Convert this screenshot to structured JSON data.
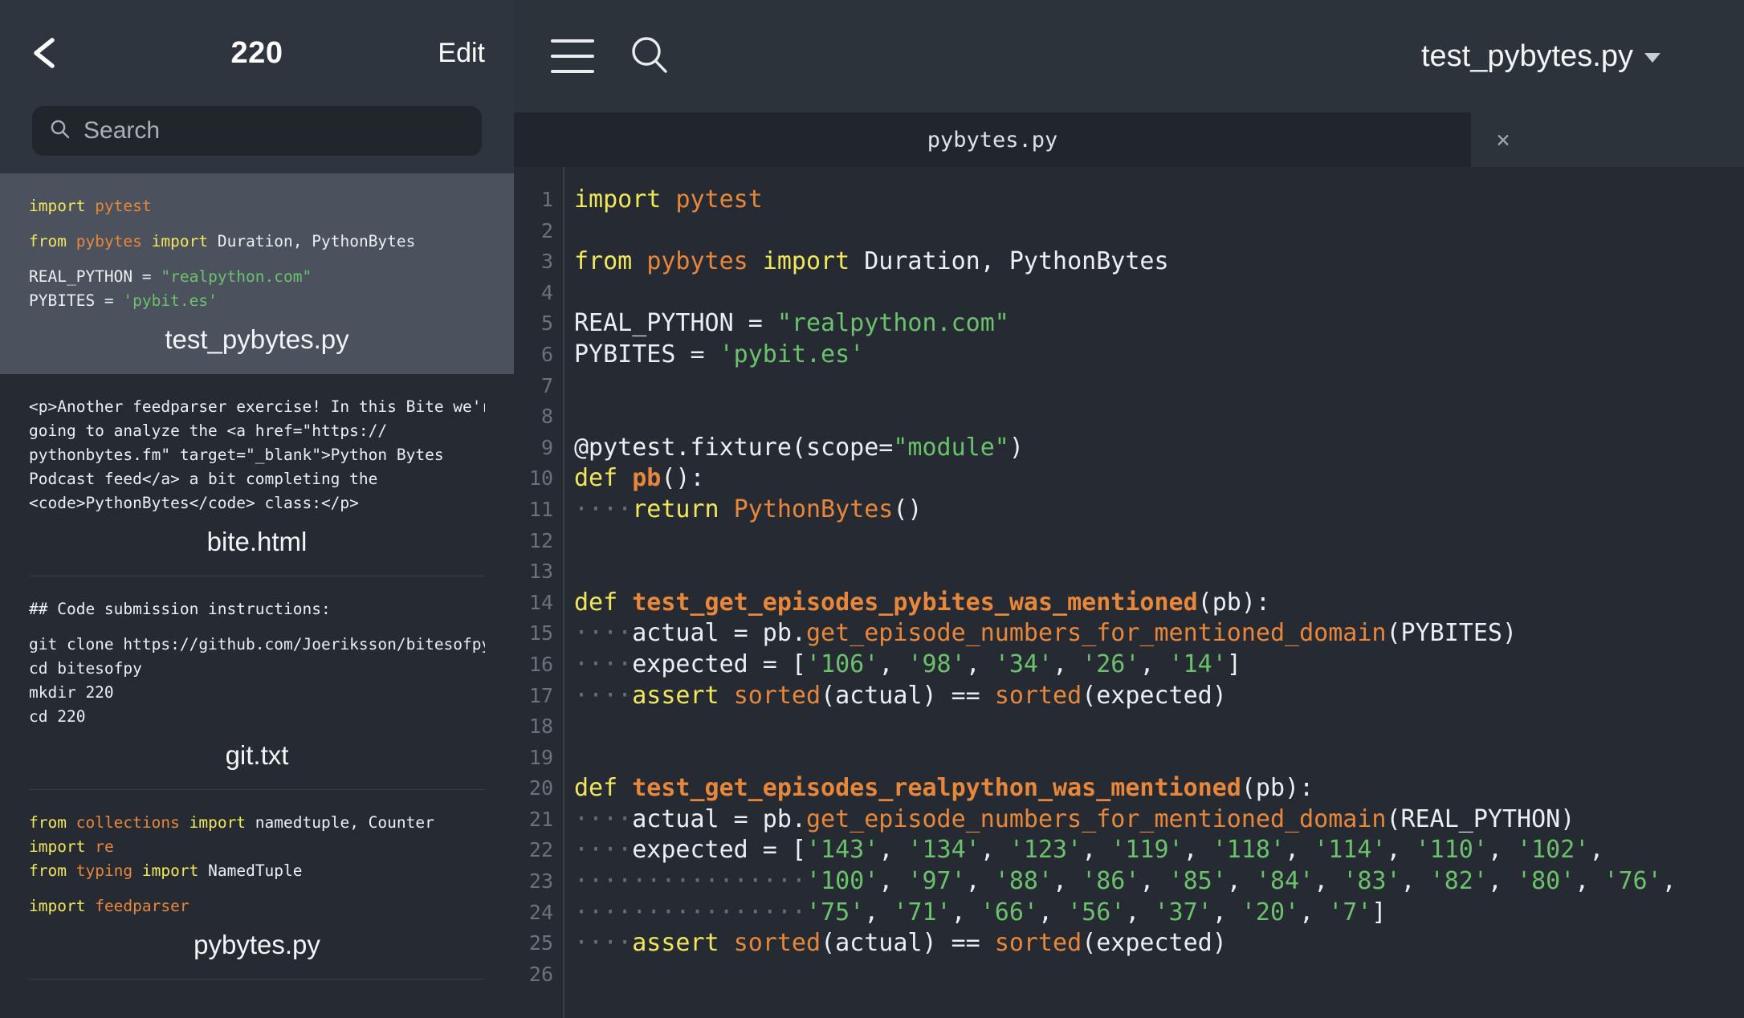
{
  "sidebar": {
    "back_icon": "chevron-left-icon",
    "title": "220",
    "edit_label": "Edit",
    "search": {
      "icon": "search-icon",
      "placeholder": "Search",
      "value": ""
    },
    "items": [
      {
        "filename": "test_pybytes.py",
        "selected": true,
        "snippet_lines": [
          [
            {
              "t": "import",
              "c": "kw"
            },
            {
              "t": " ",
              "c": "plain"
            },
            {
              "t": "pytest",
              "c": "mod"
            }
          ],
          [],
          [
            {
              "t": "from",
              "c": "kw"
            },
            {
              "t": " ",
              "c": "plain"
            },
            {
              "t": "pybytes",
              "c": "mod"
            },
            {
              "t": " ",
              "c": "plain"
            },
            {
              "t": "import",
              "c": "kw"
            },
            {
              "t": " Duration, PythonBytes",
              "c": "plain"
            }
          ],
          [],
          [
            {
              "t": "REAL_PYTHON = ",
              "c": "plain"
            },
            {
              "t": "\"realpython.com\"",
              "c": "str"
            }
          ],
          [
            {
              "t": "PYBITES = ",
              "c": "plain"
            },
            {
              "t": "'pybit.es'",
              "c": "str"
            }
          ]
        ]
      },
      {
        "filename": "bite.html",
        "selected": false,
        "snippet_lines": [
          [
            {
              "t": "<p>Another feedparser exercise! In this Bite we're",
              "c": "plain"
            }
          ],
          [
            {
              "t": "going to analyze the <a href=\"https://",
              "c": "plain"
            }
          ],
          [
            {
              "t": "pythonbytes.fm\" target=\"_blank\">Python Bytes",
              "c": "plain"
            }
          ],
          [
            {
              "t": "Podcast feed</a> a bit completing the",
              "c": "plain"
            }
          ],
          [
            {
              "t": "<code>PythonBytes</code> class:</p>",
              "c": "plain"
            }
          ]
        ]
      },
      {
        "filename": "git.txt",
        "selected": false,
        "snippet_lines": [
          [
            {
              "t": "## Code submission instructions:",
              "c": "plain"
            }
          ],
          [],
          [
            {
              "t": "git clone https://github.com/Joeriksson/bitesofpy",
              "c": "plain"
            }
          ],
          [
            {
              "t": "cd bitesofpy",
              "c": "plain"
            }
          ],
          [
            {
              "t": "mkdir 220",
              "c": "plain"
            }
          ],
          [
            {
              "t": "cd 220",
              "c": "plain"
            }
          ]
        ]
      },
      {
        "filename": "pybytes.py",
        "selected": false,
        "snippet_lines": [
          [
            {
              "t": "from",
              "c": "kw"
            },
            {
              "t": " ",
              "c": "plain"
            },
            {
              "t": "collections",
              "c": "mod"
            },
            {
              "t": " ",
              "c": "plain"
            },
            {
              "t": "import",
              "c": "kw"
            },
            {
              "t": " namedtuple, Counter",
              "c": "plain"
            }
          ],
          [
            {
              "t": "import",
              "c": "kw"
            },
            {
              "t": " ",
              "c": "plain"
            },
            {
              "t": "re",
              "c": "mod"
            }
          ],
          [
            {
              "t": "from",
              "c": "kw"
            },
            {
              "t": " ",
              "c": "plain"
            },
            {
              "t": "typing",
              "c": "mod"
            },
            {
              "t": " ",
              "c": "plain"
            },
            {
              "t": "import",
              "c": "kw"
            },
            {
              "t": " NamedTuple",
              "c": "plain"
            }
          ],
          [],
          [
            {
              "t": "import",
              "c": "kw"
            },
            {
              "t": " ",
              "c": "plain"
            },
            {
              "t": "feedparser",
              "c": "mod"
            }
          ]
        ]
      }
    ]
  },
  "editor": {
    "menu_icon": "hamburger-menu-icon",
    "search_icon": "search-icon",
    "title": "test_pybytes.py",
    "title_caret_icon": "chevron-down-icon",
    "tab": {
      "label": "pybytes.py",
      "close_label": "×",
      "close_icon": "close-icon"
    },
    "line_numbers": [
      "1",
      "2",
      "3",
      "4",
      "5",
      "6",
      "7",
      "8",
      "9",
      "10",
      "11",
      "12",
      "13",
      "14",
      "15",
      "16",
      "17",
      "18",
      "19",
      "20",
      "21",
      "22",
      "23",
      "24",
      "25",
      "26"
    ],
    "code_lines": [
      [
        {
          "t": "import",
          "c": "kw"
        },
        {
          "t": " ",
          "c": "plain"
        },
        {
          "t": "pytest",
          "c": "mod"
        }
      ],
      [],
      [
        {
          "t": "from",
          "c": "kw"
        },
        {
          "t": " ",
          "c": "plain"
        },
        {
          "t": "pybytes",
          "c": "mod"
        },
        {
          "t": " ",
          "c": "plain"
        },
        {
          "t": "import",
          "c": "kw"
        },
        {
          "t": " Duration, PythonBytes",
          "c": "plain"
        }
      ],
      [],
      [
        {
          "t": "REAL_PYTHON = ",
          "c": "plain"
        },
        {
          "t": "\"realpython.com\"",
          "c": "str"
        }
      ],
      [
        {
          "t": "PYBITES = ",
          "c": "plain"
        },
        {
          "t": "'pybit.es'",
          "c": "str"
        }
      ],
      [],
      [],
      [
        {
          "t": "@pytest.fixture(scope=",
          "c": "plain"
        },
        {
          "t": "\"module\"",
          "c": "str"
        },
        {
          "t": ")",
          "c": "plain"
        }
      ],
      [
        {
          "t": "def",
          "c": "kw"
        },
        {
          "t": " ",
          "c": "plain"
        },
        {
          "t": "pb",
          "c": "fn"
        },
        {
          "t": "():",
          "c": "plain"
        }
      ],
      [
        {
          "t": "····",
          "c": "dot"
        },
        {
          "t": "return",
          "c": "kw"
        },
        {
          "t": " ",
          "c": "plain"
        },
        {
          "t": "PythonBytes",
          "c": "mod"
        },
        {
          "t": "()",
          "c": "plain"
        }
      ],
      [],
      [],
      [
        {
          "t": "def",
          "c": "kw"
        },
        {
          "t": " ",
          "c": "plain"
        },
        {
          "t": "test_get_episodes_pybites_was_mentioned",
          "c": "fn"
        },
        {
          "t": "(pb):",
          "c": "plain"
        }
      ],
      [
        {
          "t": "····",
          "c": "dot"
        },
        {
          "t": "actual = pb.",
          "c": "plain"
        },
        {
          "t": "get_episode_numbers_for_mentioned_domain",
          "c": "meth"
        },
        {
          "t": "(PYBITES)",
          "c": "plain"
        }
      ],
      [
        {
          "t": "····",
          "c": "dot"
        },
        {
          "t": "expected = [",
          "c": "plain"
        },
        {
          "t": "'106'",
          "c": "str"
        },
        {
          "t": ", ",
          "c": "plain"
        },
        {
          "t": "'98'",
          "c": "str"
        },
        {
          "t": ", ",
          "c": "plain"
        },
        {
          "t": "'34'",
          "c": "str"
        },
        {
          "t": ", ",
          "c": "plain"
        },
        {
          "t": "'26'",
          "c": "str"
        },
        {
          "t": ", ",
          "c": "plain"
        },
        {
          "t": "'14'",
          "c": "str"
        },
        {
          "t": "]",
          "c": "plain"
        }
      ],
      [
        {
          "t": "····",
          "c": "dot"
        },
        {
          "t": "assert",
          "c": "kw"
        },
        {
          "t": " ",
          "c": "plain"
        },
        {
          "t": "sorted",
          "c": "mod"
        },
        {
          "t": "(actual) == ",
          "c": "plain"
        },
        {
          "t": "sorted",
          "c": "mod"
        },
        {
          "t": "(expected)",
          "c": "plain"
        }
      ],
      [],
      [],
      [
        {
          "t": "def",
          "c": "kw"
        },
        {
          "t": " ",
          "c": "plain"
        },
        {
          "t": "test_get_episodes_realpython_was_mentioned",
          "c": "fn"
        },
        {
          "t": "(pb):",
          "c": "plain"
        }
      ],
      [
        {
          "t": "····",
          "c": "dot"
        },
        {
          "t": "actual = pb.",
          "c": "plain"
        },
        {
          "t": "get_episode_numbers_for_mentioned_domain",
          "c": "meth"
        },
        {
          "t": "(REAL_PYTHON)",
          "c": "plain"
        }
      ],
      [
        {
          "t": "····",
          "c": "dot"
        },
        {
          "t": "expected = [",
          "c": "plain"
        },
        {
          "t": "'143'",
          "c": "str"
        },
        {
          "t": ", ",
          "c": "plain"
        },
        {
          "t": "'134'",
          "c": "str"
        },
        {
          "t": ", ",
          "c": "plain"
        },
        {
          "t": "'123'",
          "c": "str"
        },
        {
          "t": ", ",
          "c": "plain"
        },
        {
          "t": "'119'",
          "c": "str"
        },
        {
          "t": ", ",
          "c": "plain"
        },
        {
          "t": "'118'",
          "c": "str"
        },
        {
          "t": ", ",
          "c": "plain"
        },
        {
          "t": "'114'",
          "c": "str"
        },
        {
          "t": ", ",
          "c": "plain"
        },
        {
          "t": "'110'",
          "c": "str"
        },
        {
          "t": ", ",
          "c": "plain"
        },
        {
          "t": "'102'",
          "c": "str"
        },
        {
          "t": ",",
          "c": "plain"
        }
      ],
      [
        {
          "t": "················",
          "c": "dot"
        },
        {
          "t": "'100'",
          "c": "str"
        },
        {
          "t": ", ",
          "c": "plain"
        },
        {
          "t": "'97'",
          "c": "str"
        },
        {
          "t": ", ",
          "c": "plain"
        },
        {
          "t": "'88'",
          "c": "str"
        },
        {
          "t": ", ",
          "c": "plain"
        },
        {
          "t": "'86'",
          "c": "str"
        },
        {
          "t": ", ",
          "c": "plain"
        },
        {
          "t": "'85'",
          "c": "str"
        },
        {
          "t": ", ",
          "c": "plain"
        },
        {
          "t": "'84'",
          "c": "str"
        },
        {
          "t": ", ",
          "c": "plain"
        },
        {
          "t": "'83'",
          "c": "str"
        },
        {
          "t": ", ",
          "c": "plain"
        },
        {
          "t": "'82'",
          "c": "str"
        },
        {
          "t": ", ",
          "c": "plain"
        },
        {
          "t": "'80'",
          "c": "str"
        },
        {
          "t": ", ",
          "c": "plain"
        },
        {
          "t": "'76'",
          "c": "str"
        },
        {
          "t": ",",
          "c": "plain"
        }
      ],
      [
        {
          "t": "················",
          "c": "dot"
        },
        {
          "t": "'75'",
          "c": "str"
        },
        {
          "t": ", ",
          "c": "plain"
        },
        {
          "t": "'71'",
          "c": "str"
        },
        {
          "t": ", ",
          "c": "plain"
        },
        {
          "t": "'66'",
          "c": "str"
        },
        {
          "t": ", ",
          "c": "plain"
        },
        {
          "t": "'56'",
          "c": "str"
        },
        {
          "t": ", ",
          "c": "plain"
        },
        {
          "t": "'37'",
          "c": "str"
        },
        {
          "t": ", ",
          "c": "plain"
        },
        {
          "t": "'20'",
          "c": "str"
        },
        {
          "t": ", ",
          "c": "plain"
        },
        {
          "t": "'7'",
          "c": "str"
        },
        {
          "t": "]",
          "c": "plain"
        }
      ],
      [
        {
          "t": "····",
          "c": "dot"
        },
        {
          "t": "assert",
          "c": "kw"
        },
        {
          "t": " ",
          "c": "plain"
        },
        {
          "t": "sorted",
          "c": "mod"
        },
        {
          "t": "(actual) == ",
          "c": "plain"
        },
        {
          "t": "sorted",
          "c": "mod"
        },
        {
          "t": "(expected)",
          "c": "plain"
        }
      ],
      []
    ]
  },
  "colors": {
    "sidebar_bg": "#262b33",
    "sidebar_nav_bg": "#2f353e",
    "selected_row_bg": "#4b515d",
    "editor_bg": "#262b33",
    "toolbar_bg": "#2d333b",
    "tab_active_bg": "#21262e",
    "keyword": "#f2e75b",
    "module": "#e8873a",
    "string": "#6cc26c",
    "text": "#eceff2",
    "line_number": "#6b727d"
  }
}
